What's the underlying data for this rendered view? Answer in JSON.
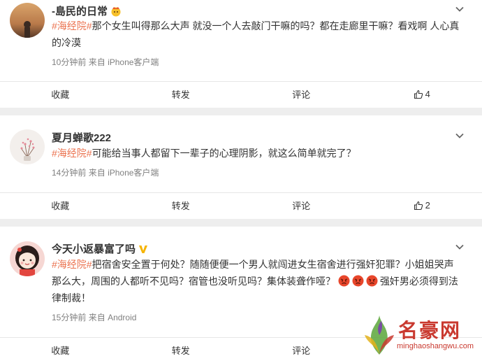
{
  "posts": [
    {
      "username": "-島民的日常",
      "hashtag": "#海经院#",
      "content": "那个女生叫得那么大声 就没一个人去敲门干嘛的吗？都在走廊里干嘛？看戏啊 人心真的冷漠",
      "time": "10分钟前",
      "source_prefix": "来自",
      "source": "iPhone客户端",
      "actions": {
        "collect": "收藏",
        "repost": "转发",
        "comment": "评论",
        "likes": "4"
      }
    },
    {
      "username": "夏月蝉歌222",
      "hashtag": "#海经院#",
      "content": "可能给当事人都留下一辈子的心理阴影，就这么简单就完了？",
      "time": "14分钟前",
      "source_prefix": "来自",
      "source": "iPhone客户端",
      "actions": {
        "collect": "收藏",
        "repost": "转发",
        "comment": "评论",
        "likes": "2"
      }
    },
    {
      "username": "今天小返暴富了吗",
      "verified": "V",
      "hashtag": "#海经院#",
      "content": "把宿舍安全置于何处？随随便便一个男人就闯进女生宿舍进行强奸犯罪？小姐姐哭声那么大，周围的人都听不见吗？宿管也没听见吗？集体装聋作哑？",
      "content_tail": "强奸男必须得到法律制裁！",
      "time": "15分钟前",
      "source_prefix": "来自",
      "source": "Android",
      "actions": {
        "collect": "收藏",
        "repost": "转发",
        "comment": "评论"
      }
    }
  ],
  "watermark": {
    "title": "名豪网",
    "url": "minghaoshangwu.com"
  },
  "colors": {
    "hashtag": "#eb7350",
    "meta": "#808080",
    "verified": "#f6b400",
    "watermark": "#c9392f"
  },
  "icons": [
    "chevron-down-icon",
    "thumbs-up-icon",
    "verified-badge-icon",
    "angry-face-emoji",
    "crown-emoji"
  ]
}
